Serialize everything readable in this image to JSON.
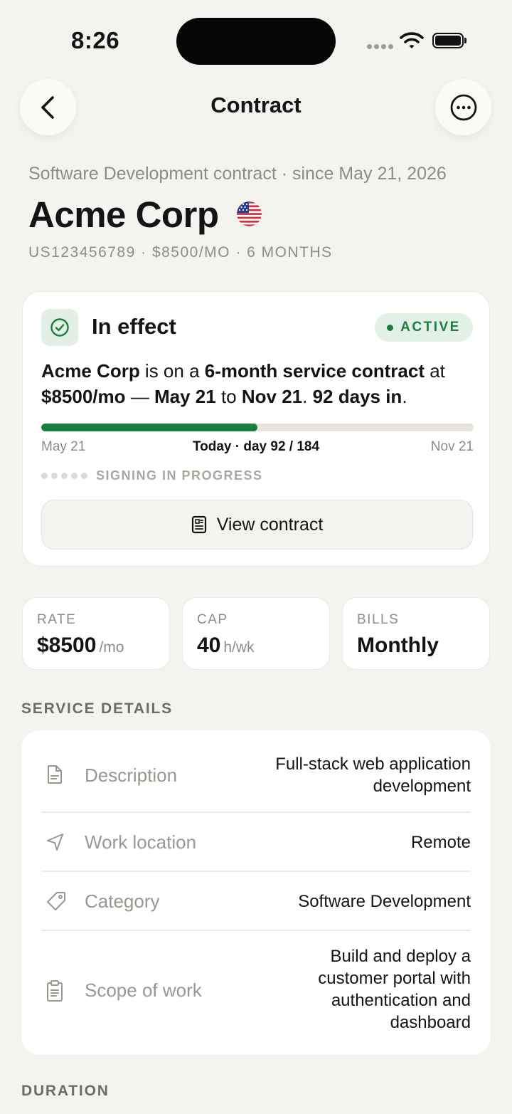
{
  "status_bar": {
    "time": "8:26"
  },
  "nav": {
    "title": "Contract"
  },
  "header": {
    "subtitle": "Software Development contract · since May 21, 2026",
    "company": "Acme Corp",
    "meta": "US123456789 · $8500/MO · 6 MONTHS"
  },
  "status_card": {
    "title": "In effect",
    "badge": "ACTIVE",
    "summary": {
      "company": "Acme Corp",
      "t1": " is on a ",
      "term": "6-month service contract",
      "t2": " at ",
      "rate": "$8500/mo",
      "t3": " — ",
      "start": "May 21",
      "t4": " to ",
      "end": "Nov 21",
      "t5": ". ",
      "days": "92 days in",
      "t6": "."
    },
    "progress": 0.5,
    "progress_start": "May 21",
    "progress_today": "Today · day 92 / 184",
    "progress_end": "Nov 21",
    "signing_status": "SIGNING IN PROGRESS",
    "view_button": "View contract",
    "accent_color": "#1a7f3e"
  },
  "stats": [
    {
      "label": "RATE",
      "value": "$8500",
      "unit": "/mo"
    },
    {
      "label": "CAP",
      "value": "40",
      "unit": "h/wk"
    },
    {
      "label": "BILLS",
      "value": "Monthly",
      "unit": ""
    }
  ],
  "service_details": {
    "heading": "SERVICE DETAILS",
    "rows": [
      {
        "icon": "document-icon",
        "label": "Description",
        "value_lines": [
          "Full-stack web application",
          "development"
        ]
      },
      {
        "icon": "location-arrow-icon",
        "label": "Work location",
        "value_lines": [
          "Remote"
        ]
      },
      {
        "icon": "tag-icon",
        "label": "Category",
        "value_lines": [
          "Software Development"
        ]
      },
      {
        "icon": "clipboard-icon",
        "label": "Scope of work",
        "value_lines": [
          "Build and deploy a",
          "customer portal with",
          "authentication and",
          "dashboard"
        ]
      }
    ]
  },
  "duration": {
    "heading": "DURATION"
  }
}
